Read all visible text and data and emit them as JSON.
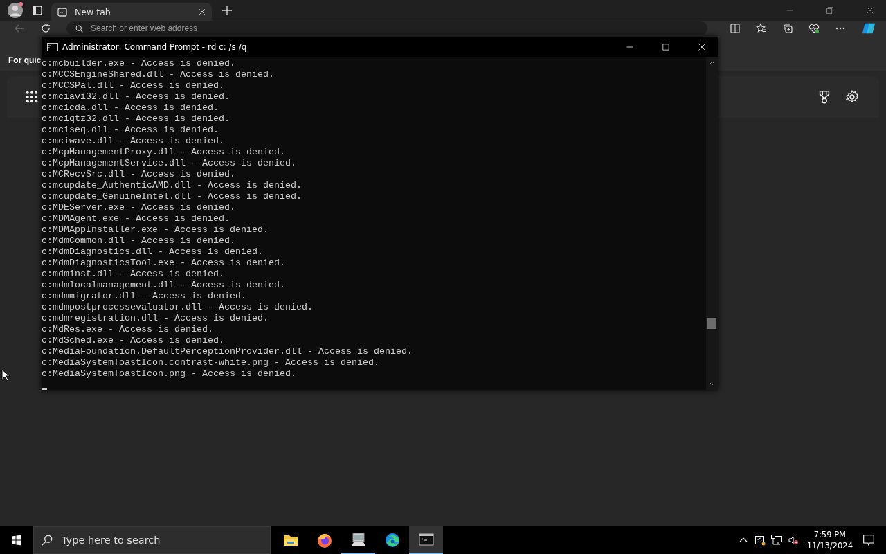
{
  "browser": {
    "tabs": [
      {
        "label": "New tab",
        "selected": true
      }
    ],
    "address_bar": {
      "placeholder": "Search or enter web address"
    },
    "favorites_bar": {
      "text": "For quic"
    }
  },
  "console_window": {
    "title": "Administrator: Command Prompt - rd  c: /s /q",
    "lines": [
      "c:mcbuilder.exe - Access is denied.",
      "c:MCCSEngineShared.dll - Access is denied.",
      "c:MCCSPal.dll - Access is denied.",
      "c:mciavi32.dll - Access is denied.",
      "c:mcicda.dll - Access is denied.",
      "c:mciqtz32.dll - Access is denied.",
      "c:mciseq.dll - Access is denied.",
      "c:mciwave.dll - Access is denied.",
      "c:McpManagementProxy.dll - Access is denied.",
      "c:McpManagementService.dll - Access is denied.",
      "c:MCRecvSrc.dll - Access is denied.",
      "c:mcupdate_AuthenticAMD.dll - Access is denied.",
      "c:mcupdate_GenuineIntel.dll - Access is denied.",
      "c:MDEServer.exe - Access is denied.",
      "c:MDMAgent.exe - Access is denied.",
      "c:MDMAppInstaller.exe - Access is denied.",
      "c:MdmCommon.dll - Access is denied.",
      "c:MdmDiagnostics.dll - Access is denied.",
      "c:MdmDiagnosticsTool.exe - Access is denied.",
      "c:mdminst.dll - Access is denied.",
      "c:mdmlocalmanagement.dll - Access is denied.",
      "c:mdmmigrator.dll - Access is denied.",
      "c:mdmpostprocessevaluator.dll - Access is denied.",
      "c:mdmregistration.dll - Access is denied.",
      "c:MdRes.exe - Access is denied.",
      "c:MdSched.exe - Access is denied.",
      "c:MediaFoundation.DefaultPerceptionProvider.dll - Access is denied.",
      "c:MediaSystemToastIcon.contrast-white.png - Access is denied.",
      "c:MediaSystemToastIcon.png - Access is denied."
    ]
  },
  "taskbar": {
    "search": {
      "placeholder": "Type here to search"
    },
    "apps": [
      {
        "kind": "folder",
        "running": false,
        "selected": false
      },
      {
        "kind": "firefox",
        "running": false,
        "selected": false
      },
      {
        "kind": "computer",
        "running": true,
        "selected": false
      },
      {
        "kind": "edge",
        "running": false,
        "selected": false
      },
      {
        "kind": "console",
        "running": true,
        "selected": true
      }
    ],
    "clock": {
      "time": "7:59 PM",
      "date": "11/13/2024"
    }
  }
}
